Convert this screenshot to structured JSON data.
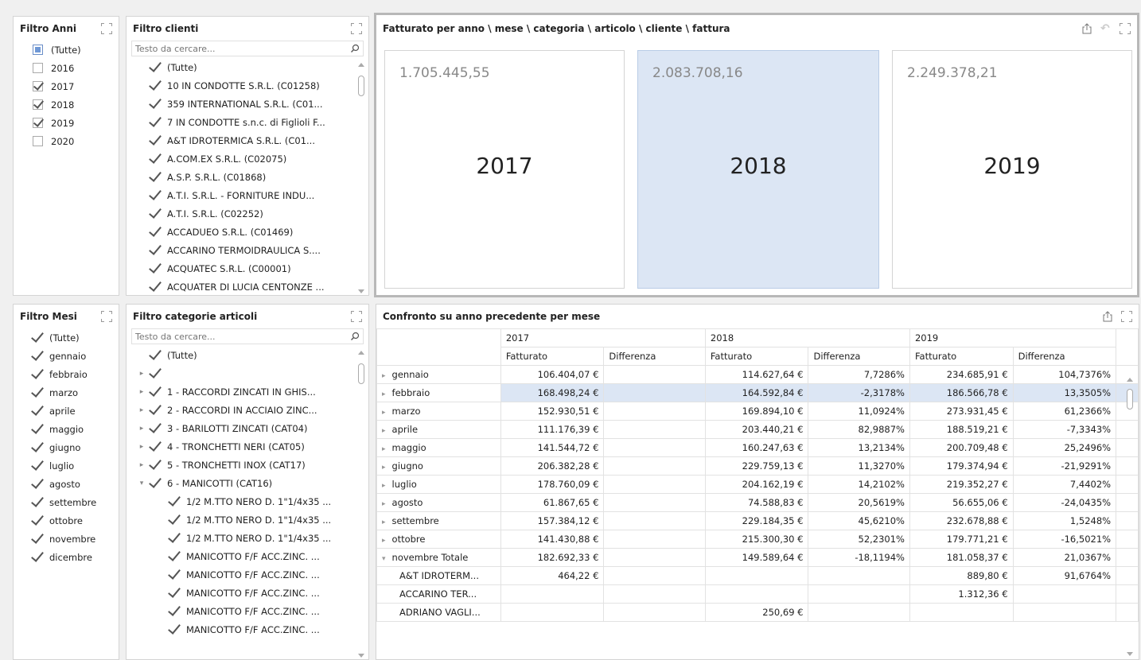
{
  "anni": {
    "title": "Filtro Anni",
    "items": [
      {
        "label": "(Tutte)",
        "state": "indet"
      },
      {
        "label": "2016",
        "state": "off"
      },
      {
        "label": "2017",
        "state": "on"
      },
      {
        "label": "2018",
        "state": "on"
      },
      {
        "label": "2019",
        "state": "on"
      },
      {
        "label": "2020",
        "state": "off"
      }
    ]
  },
  "clienti": {
    "title": "Filtro clienti",
    "search_placeholder": "Testo da cercare...",
    "items": [
      "(Tutte)",
      "10 IN CONDOTTE S.R.L. (C01258)",
      "359 INTERNATIONAL S.R.L. (C01...",
      "7 IN CONDOTTE s.n.c. di Figlioli F...",
      "A&T IDROTERMICA S.R.L. (C01...",
      "A.COM.EX S.R.L. (C02075)",
      "A.S.P. S.R.L. (C01868)",
      "A.T.I. S.R.L. - FORNITURE INDU...",
      "A.T.I. S.R.L. (C02252)",
      "ACCADUEO S.R.L. (C01469)",
      "ACCARINO TERMOIDRAULICA S....",
      "ACQUATEC S.R.L. (C00001)",
      "ACQUATER DI LUCIA CENTONZE ..."
    ]
  },
  "fatturato": {
    "title": "Fatturato per anno \\ mese \\ categoria \\ articolo \\ cliente \\ fattura",
    "cards": [
      {
        "value": "1.705.445,55",
        "year": "2017",
        "selected": false
      },
      {
        "value": "2.083.708,16",
        "year": "2018",
        "selected": true
      },
      {
        "value": "2.249.378,21",
        "year": "2019",
        "selected": false
      }
    ]
  },
  "mesi": {
    "title": "Filtro Mesi",
    "items": [
      "(Tutte)",
      "gennaio",
      "febbraio",
      "marzo",
      "aprile",
      "maggio",
      "giugno",
      "luglio",
      "agosto",
      "settembre",
      "ottobre",
      "novembre",
      "dicembre"
    ]
  },
  "categorie": {
    "title": "Filtro categorie articoli",
    "search_placeholder": "Testo da cercare...",
    "items": [
      {
        "label": "(Tutte)",
        "exp": "",
        "indent": 0
      },
      {
        "label": "",
        "exp": "▸",
        "indent": 0
      },
      {
        "label": "1 - RACCORDI ZINCATI IN GHIS...",
        "exp": "▸",
        "indent": 0
      },
      {
        "label": "2 - RACCORDI IN ACCIAIO ZINC...",
        "exp": "▸",
        "indent": 0
      },
      {
        "label": "3 - BARILOTTI  ZINCATI (CAT04)",
        "exp": "▸",
        "indent": 0
      },
      {
        "label": "4 - TRONCHETTI NERI (CAT05)",
        "exp": "▸",
        "indent": 0
      },
      {
        "label": "5 - TRONCHETTI  INOX (CAT17)",
        "exp": "▸",
        "indent": 0
      },
      {
        "label": "6 - MANICOTTI (CAT16)",
        "exp": "▾",
        "indent": 0
      },
      {
        "label": "1/2 M.TTO NERO D. 1\"1/4x35 ...",
        "exp": "",
        "indent": 1
      },
      {
        "label": "1/2 M.TTO NERO D. 1\"1/4x35 ...",
        "exp": "",
        "indent": 1
      },
      {
        "label": "1/2 M.TTO NERO D. 1\"1/4x35 ...",
        "exp": "",
        "indent": 1
      },
      {
        "label": "MANICOTTO F/F ACC.ZINC. ...",
        "exp": "",
        "indent": 1
      },
      {
        "label": "MANICOTTO F/F ACC.ZINC. ...",
        "exp": "",
        "indent": 1
      },
      {
        "label": "MANICOTTO F/F ACC.ZINC. ...",
        "exp": "",
        "indent": 1
      },
      {
        "label": "MANICOTTO F/F ACC.ZINC. ...",
        "exp": "",
        "indent": 1
      },
      {
        "label": "MANICOTTO F/F ACC.ZINC. ...",
        "exp": "",
        "indent": 1
      }
    ]
  },
  "confronto": {
    "title": "Confronto su anno precedente per mese",
    "years": [
      "2017",
      "2018",
      "2019"
    ],
    "col_fatturato": "Fatturato",
    "col_differenza": "Differenza",
    "rows": [
      {
        "label": "gennaio",
        "chev": "▸",
        "sub": false,
        "sel": false,
        "v": [
          "106.404,07 €",
          "",
          "114.627,64 €",
          "7,7286%",
          "234.685,91 €",
          "104,7376%"
        ]
      },
      {
        "label": "febbraio",
        "chev": "▸",
        "sub": false,
        "sel": true,
        "v": [
          "168.498,24 €",
          "",
          "164.592,84 €",
          "-2,3178%",
          "186.566,78 €",
          "13,3505%"
        ]
      },
      {
        "label": "marzo",
        "chev": "▸",
        "sub": false,
        "sel": false,
        "v": [
          "152.930,51 €",
          "",
          "169.894,10 €",
          "11,0924%",
          "273.931,45 €",
          "61,2366%"
        ]
      },
      {
        "label": "aprile",
        "chev": "▸",
        "sub": false,
        "sel": false,
        "v": [
          "111.176,39 €",
          "",
          "203.440,21 €",
          "82,9887%",
          "188.519,21 €",
          "-7,3343%"
        ]
      },
      {
        "label": "maggio",
        "chev": "▸",
        "sub": false,
        "sel": false,
        "v": [
          "141.544,72 €",
          "",
          "160.247,63 €",
          "13,2134%",
          "200.709,48 €",
          "25,2496%"
        ]
      },
      {
        "label": "giugno",
        "chev": "▸",
        "sub": false,
        "sel": false,
        "v": [
          "206.382,28 €",
          "",
          "229.759,13 €",
          "11,3270%",
          "179.374,94 €",
          "-21,9291%"
        ]
      },
      {
        "label": "luglio",
        "chev": "▸",
        "sub": false,
        "sel": false,
        "v": [
          "178.760,09 €",
          "",
          "204.162,19 €",
          "14,2102%",
          "219.352,27 €",
          "7,4402%"
        ]
      },
      {
        "label": "agosto",
        "chev": "▸",
        "sub": false,
        "sel": false,
        "v": [
          "61.867,65 €",
          "",
          "74.588,83 €",
          "20,5619%",
          "56.655,06 €",
          "-24,0435%"
        ]
      },
      {
        "label": "settembre",
        "chev": "▸",
        "sub": false,
        "sel": false,
        "v": [
          "157.384,12 €",
          "",
          "229.184,35 €",
          "45,6210%",
          "232.678,88 €",
          "1,5248%"
        ]
      },
      {
        "label": "ottobre",
        "chev": "▸",
        "sub": false,
        "sel": false,
        "v": [
          "141.430,88 €",
          "",
          "215.300,30 €",
          "52,2301%",
          "179.771,21 €",
          "-16,5021%"
        ]
      },
      {
        "label": "novembre Totale",
        "chev": "▾",
        "sub": false,
        "sel": false,
        "v": [
          "182.692,33 €",
          "",
          "149.589,64 €",
          "-18,1194%",
          "181.058,37 €",
          "21,0367%"
        ]
      },
      {
        "label": "A&T IDROTERM...",
        "chev": "",
        "sub": true,
        "sel": false,
        "v": [
          "464,22 €",
          "",
          "",
          "",
          "889,80 €",
          "91,6764%"
        ]
      },
      {
        "label": "ACCARINO TER...",
        "chev": "",
        "sub": true,
        "sel": false,
        "v": [
          "",
          "",
          "",
          "",
          "1.312,36 €",
          ""
        ]
      },
      {
        "label": "ADRIANO VAGLI...",
        "chev": "",
        "sub": true,
        "sel": false,
        "v": [
          "",
          "",
          "250,69 €",
          "",
          "",
          ""
        ]
      }
    ]
  }
}
